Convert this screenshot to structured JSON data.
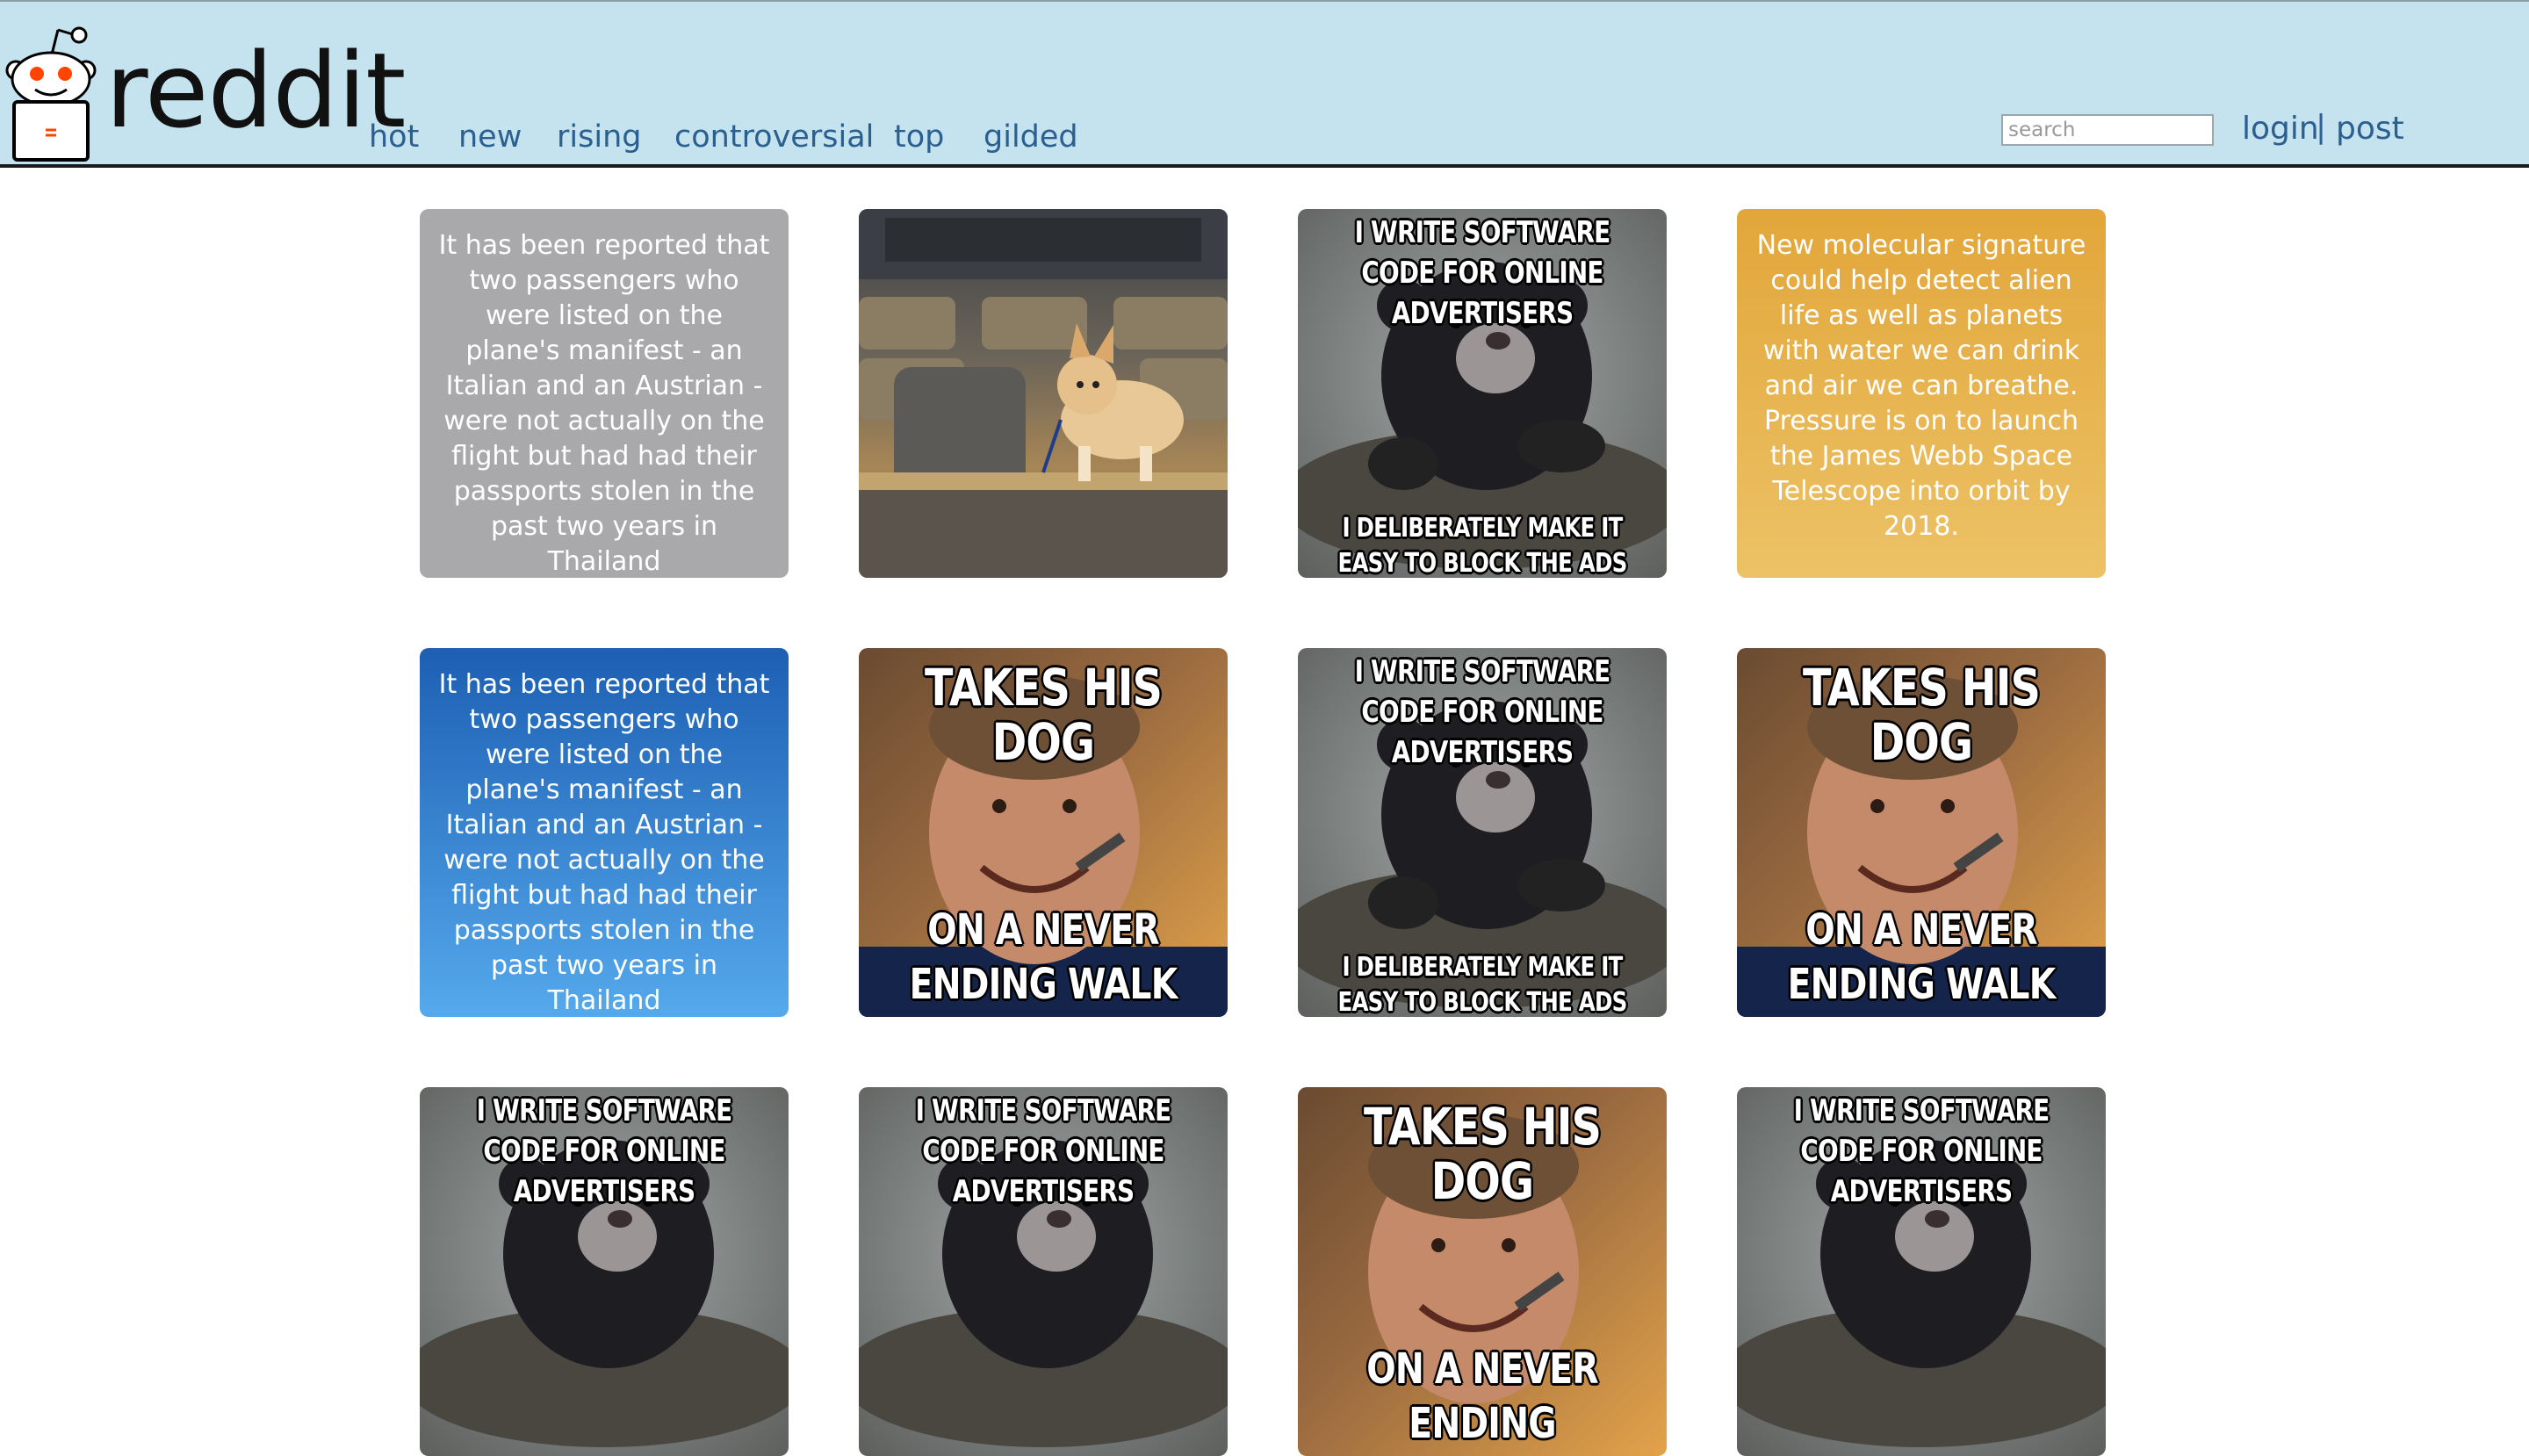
{
  "header": {
    "logo_text": "reddit",
    "nav": [
      "hot",
      "new",
      "rising",
      "controversial",
      "top",
      "gilded"
    ],
    "search": {
      "placeholder": "search",
      "value": ""
    },
    "login_label": "login",
    "separator": "|",
    "post_label": "post"
  },
  "colors": {
    "header_bg": "#c5e3ef",
    "link": "#2a5f8f",
    "card_gray": "#a9a9ab",
    "card_orange": "#e2a63a",
    "card_blue": "#1d5fb3"
  },
  "posts": [
    {
      "kind": "text",
      "style": "gray",
      "text": "It has been reported that two passengers who were listed on the plane's manifest - an Italian and an Austrian - were not actually on the flight but had had their passports stolen in the past two years in Thailand"
    },
    {
      "kind": "image",
      "image": "corgi-puppy-in-lecture-hall"
    },
    {
      "kind": "meme",
      "image": "confession-bear",
      "top": "I WRITE SOFTWARE CODE FOR ONLINE ADVERTISERS",
      "bottom": "I DELIBERATELY MAKE IT EASY TO BLOCK THE ADS"
    },
    {
      "kind": "text",
      "style": "orange",
      "text": "New molecular signature could help detect alien life as well as planets with water we can drink and air we can breathe. Pressure is on to launch the James Webb Space Telescope into orbit by 2018."
    },
    {
      "kind": "text",
      "style": "blue",
      "text": "It has been reported that two passengers who were listed on the plane's manifest - an Italian and an Austrian - were not actually on the flight but had had their passports stolen in the past two years in Thailand"
    },
    {
      "kind": "meme",
      "image": "good-guy-greg",
      "top": "TAKES HIS DOG",
      "bottom": "ON A NEVER ENDING WALK"
    },
    {
      "kind": "meme",
      "image": "confession-bear",
      "top": "I WRITE SOFTWARE CODE FOR ONLINE ADVERTISERS",
      "bottom": "I DELIBERATELY MAKE IT EASY TO BLOCK THE ADS"
    },
    {
      "kind": "meme",
      "image": "good-guy-greg",
      "top": "TAKES HIS DOG",
      "bottom": "ON A NEVER ENDING WALK"
    },
    {
      "kind": "meme",
      "image": "confession-bear",
      "top": "I WRITE SOFTWARE CODE FOR ONLINE ADVERTISERS",
      "bottom": ""
    },
    {
      "kind": "meme",
      "image": "confession-bear",
      "top": "I WRITE SOFTWARE CODE FOR ONLINE ADVERTISERS",
      "bottom": ""
    },
    {
      "kind": "meme",
      "image": "good-guy-greg",
      "top": "TAKES HIS DOG",
      "bottom": "ON A NEVER ENDING"
    },
    {
      "kind": "meme",
      "image": "confession-bear",
      "top": "I WRITE SOFTWARE CODE FOR ONLINE ADVERTISERS",
      "bottom": ""
    }
  ]
}
